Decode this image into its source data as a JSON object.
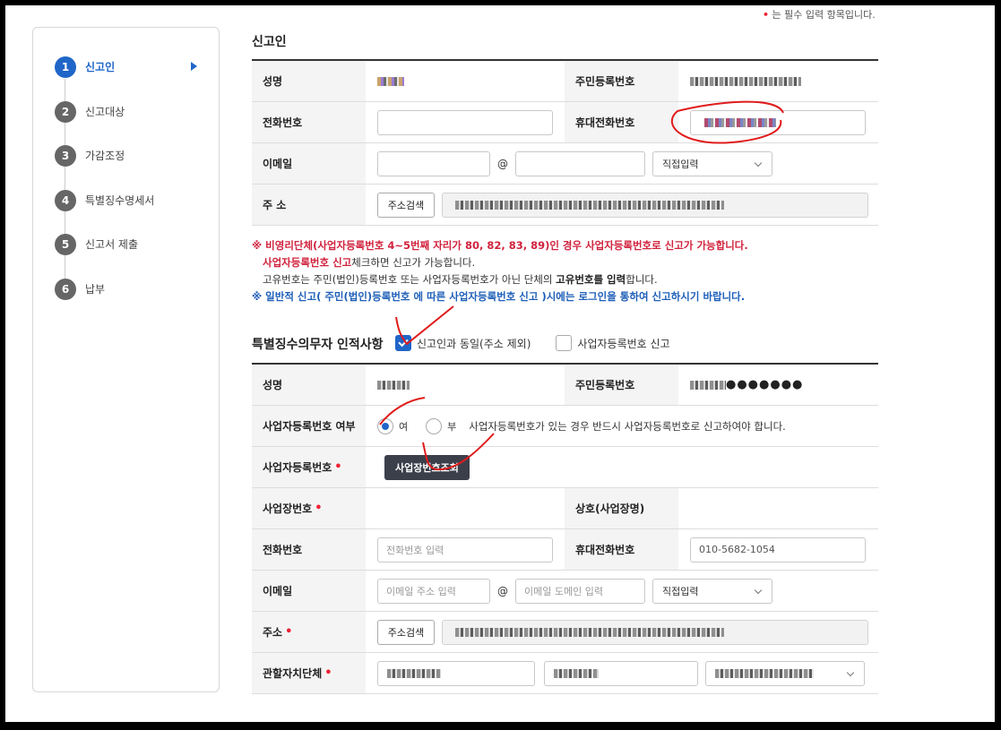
{
  "top_note": {
    "text": "는 필수 입력 항목입니다."
  },
  "sidebar": {
    "steps": [
      {
        "num": "1",
        "label": "신고인",
        "active": true
      },
      {
        "num": "2",
        "label": "신고대상"
      },
      {
        "num": "3",
        "label": "가감조정"
      },
      {
        "num": "4",
        "label": "특별징수명세서"
      },
      {
        "num": "5",
        "label": "신고서 제출"
      },
      {
        "num": "6",
        "label": "납부"
      }
    ]
  },
  "reporter": {
    "title": "신고인",
    "name_label": "성명",
    "rrn_label": "주민등록번호",
    "phone_label": "전화번호",
    "mobile_label": "휴대전화번호",
    "email_label": "이메일",
    "email_at": "@",
    "email_domain_select": "직접입력",
    "address_label": "주 소",
    "address_search": "주소검색"
  },
  "notice": {
    "line1_mark": "※ 비영리단체(사업자등록번호 4~5번째 자리가 80, 82, 83, 89)인 경우 사업자등록번호로 신고가 가능합니다.",
    "line2_bold": "사업자등록번호 신고",
    "line2_rest": "체크하면 신고가 가능합니다.",
    "line3_a": "고유번호는 주민(법인)등록번호 또는 사업자등록번호가 아닌 단체의 ",
    "line3_bold": "고유번호를 입력",
    "line3_end": "합니다.",
    "line4": "※ 일반적 신고( 주민(법인)등록번호 에 따른 사업자등록번호 신고 )시에는 로그인을 통하여 신고하시기 바랍니다."
  },
  "withholder": {
    "title": "특별징수의무자 인적사항",
    "same_as_reporter": "신고인과 동일(주소 제외)",
    "biz_no_report": "사업자등록번호 신고",
    "name_label": "성명",
    "rrn_label": "주민등록번호",
    "rrn_dots": "●●●●●●●",
    "biz_yn_label": "사업자등록번호 여부",
    "yes": "여",
    "no": "부",
    "biz_help": "사업자등록번호가 있는 경우 반드시 사업자등록번호로 신고하여야 합니다.",
    "biz_no_label": "사업자등록번호",
    "biz_lookup": "사업장번호조회",
    "workplace_no_label": "사업장번호",
    "trade_name_label": "상호(사업장명)",
    "phone_label": "전화번호",
    "phone_placeholder": "전화번호 입력",
    "mobile_label": "휴대전화번호",
    "mobile_value": "010-5682-1054",
    "email_label": "이메일",
    "email_id_placeholder": "이메일 주소 입력",
    "email_at": "@",
    "email_domain_placeholder": "이메일 도메인 입력",
    "email_domain_select": "직접입력",
    "address_label": "주소",
    "address_search": "주소검색",
    "jurisdiction_label": "관할자치단체"
  },
  "colors": {
    "accent": "#1f66c8",
    "required": "#e22233",
    "notice_red": "#d0223d",
    "notice_blue": "#1f5fb8"
  }
}
